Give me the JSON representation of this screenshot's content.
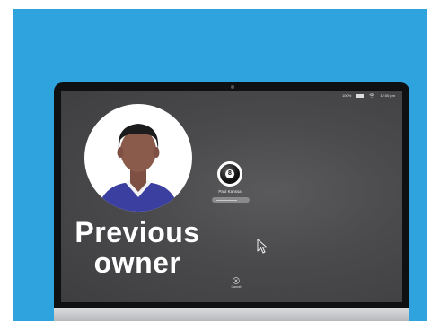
{
  "status_bar": {
    "battery_text": "100%",
    "time": "12:00 pm"
  },
  "login": {
    "user_name": "Paul Kanssa",
    "password_placeholder": "",
    "cancel_label": "Cancel"
  },
  "overlay": {
    "caption_line1": "Previous",
    "caption_line2": "owner"
  },
  "colors": {
    "background": "#2fa3de",
    "screen": "#4a4a4c",
    "shirt": "#3b3fa0",
    "skin": "#8a5a4a"
  }
}
